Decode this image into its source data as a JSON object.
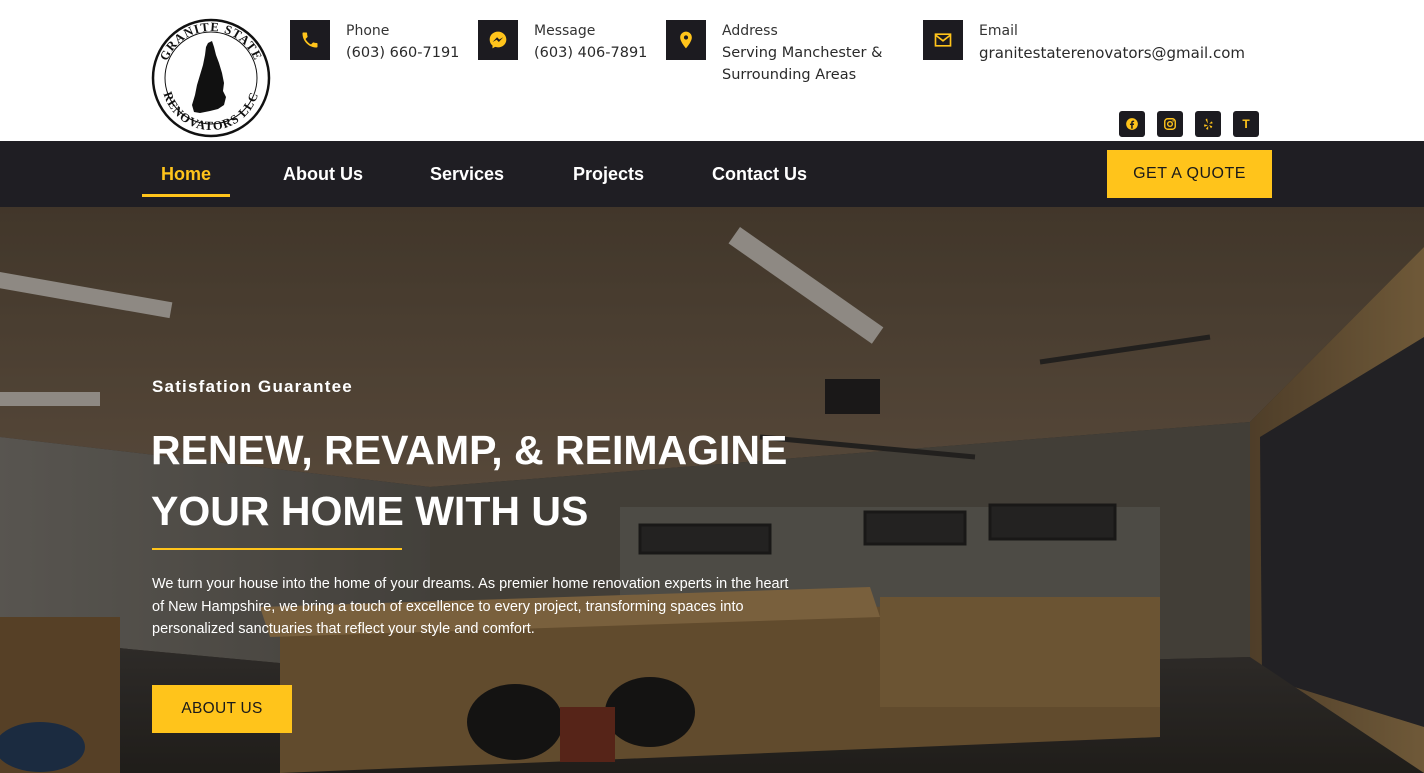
{
  "brand": {
    "logo_text_top": "GRANITE STATE",
    "logo_text_bottom": "RENOVATORS LLC"
  },
  "contacts": {
    "phone": {
      "label": "Phone",
      "value": "(603) 660-7191",
      "icon": "phone-icon"
    },
    "message": {
      "label": "Message",
      "value": "(603) 406-7891",
      "icon": "messenger-icon"
    },
    "address": {
      "label": "Address",
      "value": "Serving Manchester & Surrounding Areas",
      "icon": "map-pin-icon"
    },
    "email": {
      "label": "Email",
      "value": "granitestaterenovators@gmail.com",
      "icon": "envelope-icon"
    }
  },
  "socials": {
    "facebook": "facebook-icon",
    "instagram": "instagram-icon",
    "yelp": "yelp-icon",
    "t_label": "T"
  },
  "nav": {
    "home": "Home",
    "about": "About Us",
    "services": "Services",
    "projects": "Projects",
    "contact": "Contact Us",
    "cta": "GET A QUOTE"
  },
  "hero": {
    "eyebrow": "Satisfation Guarantee",
    "headline": "RENEW, REVAMP, & REIMAGINE YOUR HOME WITH US",
    "description": "We turn your house into the home of your dreams. As premier home renovation experts in the heart of New Hampshire, we bring a touch of excellence to every project, transforming spaces into personalized sanctuaries that reflect your style and comfort.",
    "button": "ABOUT US"
  },
  "colors": {
    "accent": "#ffc41b",
    "dark": "#1f1e23",
    "icon_box": "#1c1b20"
  }
}
